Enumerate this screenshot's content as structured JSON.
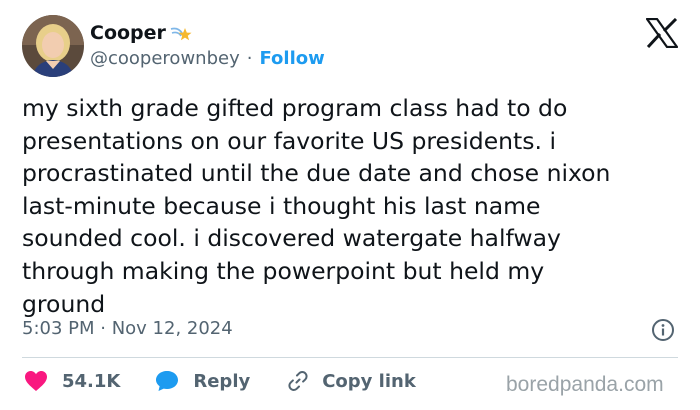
{
  "header": {
    "display_name": "Cooper",
    "handle": "@cooperownbey",
    "separator": "·",
    "follow_label": "Follow"
  },
  "icons": {
    "badge": "shooting-star-icon",
    "platform": "x-logo-icon",
    "info": "info-icon",
    "like": "heart-icon",
    "reply": "reply-bubble-icon",
    "copy": "link-icon"
  },
  "tweet": {
    "text": "my sixth grade gifted program class had to do\npresentations on our favorite US presidents. i\nprocrastinated until the due date and chose nixon\nlast-minute because i thought his last name\nsounded cool. i discovered watergate halfway\nthrough making the powerpoint but held my\nground",
    "timestamp": "5:03 PM · Nov 12, 2024"
  },
  "actions": {
    "like_count": "54.1K",
    "reply_label": "Reply",
    "copy_label": "Copy link"
  },
  "watermark": "boredpanda.com",
  "colors": {
    "like": "#f91880",
    "reply": "#1d9bf0",
    "link_accent": "#1d9bf0",
    "secondary_text": "#536471"
  }
}
